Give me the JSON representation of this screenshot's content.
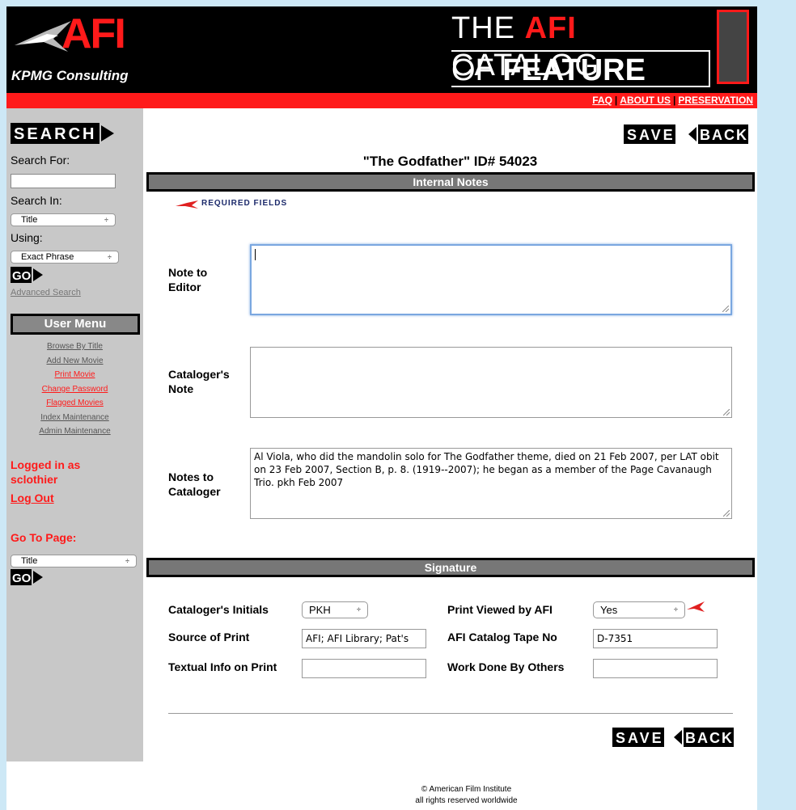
{
  "header": {
    "afi_logo": "AFI",
    "kpmg_logo": "KPMG Consulting",
    "catalog_line1_pre": "THE ",
    "catalog_line1_afi": "AFI",
    "catalog_line1_post": " CATALOG",
    "catalog_line2_pre": "OF ",
    "catalog_line2_bold": "FEATURE FILMS",
    "links": [
      "FAQ",
      "ABOUT US",
      "PRESERVATION"
    ]
  },
  "sidebar": {
    "search_heading": "SEARCH",
    "search_for_label": "Search For:",
    "search_for_value": "",
    "search_in_label": "Search In:",
    "search_in_value": "Title",
    "using_label": "Using:",
    "using_value": "Exact Phrase",
    "go_label": "GO",
    "advanced_search": "Advanced Search",
    "user_menu_title": "User Menu",
    "menu_items": [
      {
        "label": "Browse By Title",
        "color": "#555555"
      },
      {
        "label": "Add New Movie",
        "color": "#555555"
      },
      {
        "label": "Print Movie",
        "color": "#ff1a1a"
      },
      {
        "label": "Change Password",
        "color": "#ff1a1a"
      },
      {
        "label": "Flagged Movies",
        "color": "#ff1a1a"
      },
      {
        "label": "Index Maintenance",
        "color": "#555555"
      },
      {
        "label": "Admin Maintenance",
        "color": "#555555"
      }
    ],
    "logged_in_line1": "Logged in as",
    "logged_in_user": "sclothier",
    "logout": "Log Out",
    "goto_label": "Go To Page:",
    "goto_value": "Title"
  },
  "main": {
    "save_label": "SAVE",
    "back_label": "BACK",
    "title": "\"The Godfather\" ID# 54023",
    "internal_notes_heading": "Internal Notes",
    "required_fields": "REQUIRED FIELDS",
    "note_to_editor_label1": "Note to",
    "note_to_editor_label2": "Editor",
    "note_to_editor_value": "",
    "catalogers_note_label1": "Cataloger's",
    "catalogers_note_label2": "Note",
    "catalogers_note_value": "",
    "notes_to_cataloger_label1": "Notes to",
    "notes_to_cataloger_label2": "Cataloger",
    "notes_to_cataloger_value": "Al Viola, who did the mandolin solo for The Godfather theme, died on 21 Feb 2007, per LAT obit on 23 Feb 2007, Section B, p. 8.  (1919--2007);  he began as a member of the Page Cavanaugh Trio.  pkh Feb 2007",
    "signature_heading": "Signature",
    "catalogers_initials_label": "Cataloger's Initials",
    "catalogers_initials_value": "PKH",
    "print_viewed_label": "Print Viewed by AFI",
    "print_viewed_value": "Yes",
    "source_of_print_label": "Source of Print",
    "source_of_print_value": "AFI; AFI Library;  Pat's",
    "tape_no_label": "AFI Catalog Tape No",
    "tape_no_value": "D-7351",
    "textual_info_label": "Textual Info on Print",
    "textual_info_value": "",
    "work_done_label": "Work Done By Others",
    "work_done_value": "",
    "copyright_line1": "© American Film Institute",
    "copyright_line2": "all rights reserved worldwide"
  },
  "colors": {
    "accent_red": "#ff1a1a",
    "sidebar_bg": "#c8c8c8",
    "section_bar": "#777777",
    "page_bg": "#cde8f6"
  }
}
